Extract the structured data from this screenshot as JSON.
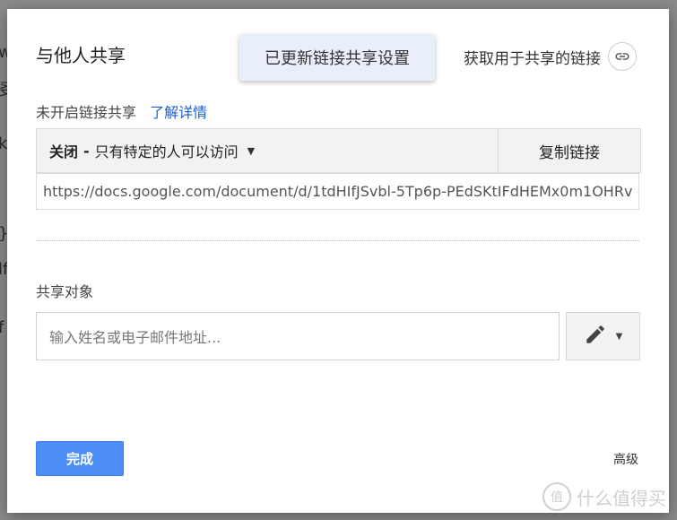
{
  "background": {
    "chars": [
      "w",
      "㕛",
      "k",
      "}",
      "lf",
      "f"
    ]
  },
  "dialog": {
    "title": "与他人共享",
    "toast": "已更新链接共享设置",
    "get_link_label": "获取用于共享的链接",
    "link_status": "未开启链接共享",
    "learn_more": "了解详情",
    "access": {
      "state": "关闭",
      "separator": "-",
      "description": "只有特定的人可以访问"
    },
    "copy_link_label": "复制链接",
    "url": "https://docs.google.com/document/d/1tdHIfJSvbl-5Tp6p-PEdSKtIFdHEMx0m1OHRv",
    "share_with_label": "共享对象",
    "people_placeholder": "输入姓名或电子邮件地址...",
    "done_label": "完成",
    "advanced_label": "高级"
  },
  "watermark": {
    "icon_text": "值",
    "text": "什么值得买"
  },
  "colors": {
    "accent": "#4d8ef6",
    "link": "#1a5fd0",
    "toast_bg": "#e8eefa"
  }
}
